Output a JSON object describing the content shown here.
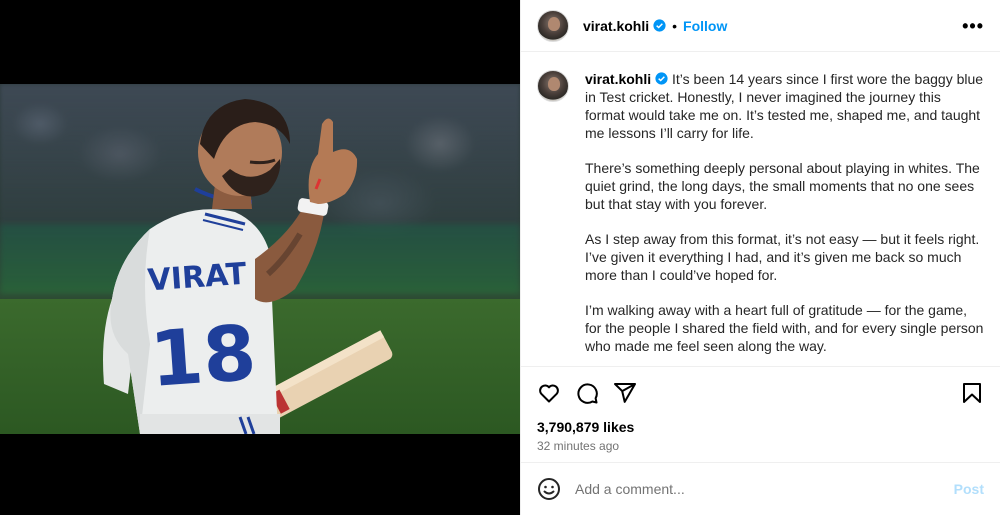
{
  "header": {
    "username": "virat.kohli",
    "follow_label": "Follow",
    "separator": "•",
    "more_icon": "more-horizontal-icon"
  },
  "caption": {
    "username": "virat.kohli",
    "paragraphs": [
      "It’s been 14 years since I first wore the baggy blue in Test cricket. Honestly, I never imagined the journey this format would take me on. It’s tested me, shaped me, and taught me lessons I’ll carry for life.",
      "There’s something deeply personal about playing in whites. The quiet grind, the long days, the small moments that no one sees but that stay with you forever.",
      "As I step away from this format, it’s not easy — but it feels right. I’ve given it everything I had, and it’s given me back so much more than I could’ve hoped for.",
      "I’m walking away with a heart full of gratitude — for the game, for the people I shared the field with, and for every single person who made me feel seen along the way."
    ]
  },
  "actions": {
    "icons": [
      "heart-icon",
      "comment-icon",
      "share-icon",
      "bookmark-icon"
    ]
  },
  "likes": "3,790,879 likes",
  "time": "32 minutes ago",
  "comment": {
    "placeholder": "Add a comment...",
    "post_label": "Post"
  },
  "media": {
    "jersey_name": "VIRAT",
    "jersey_number": "18"
  },
  "colors": {
    "accent": "#0095f6",
    "post_disabled": "#b2dffc",
    "jersey_blue": "#1f3f9a"
  }
}
